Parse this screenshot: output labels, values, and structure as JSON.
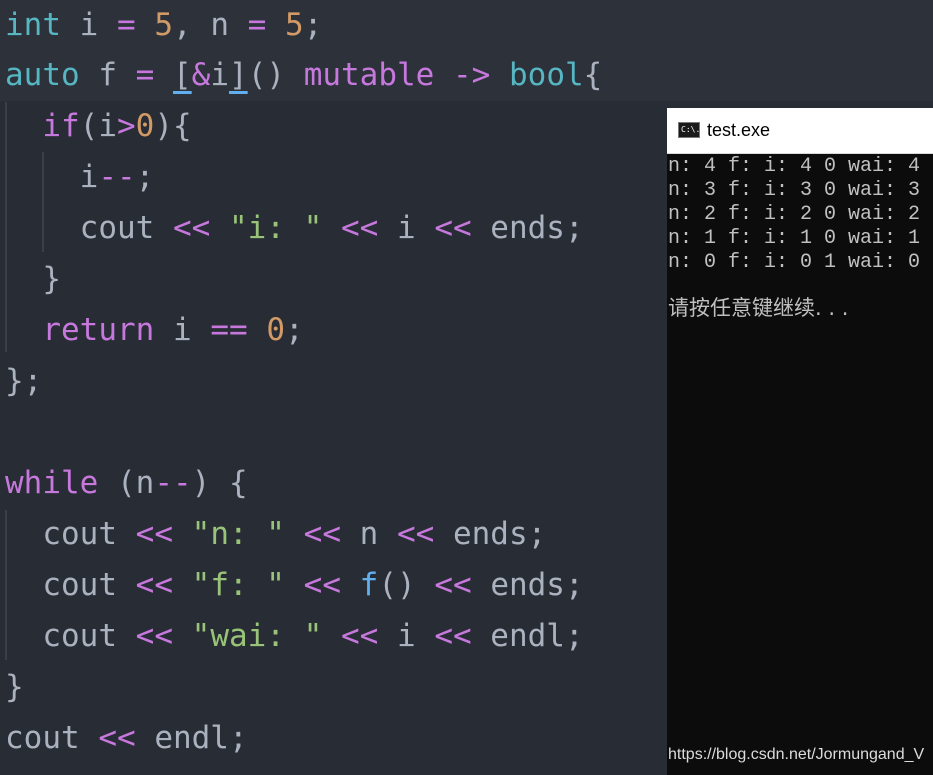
{
  "editor": {
    "lines": [
      {
        "id": "l1",
        "tokens": [
          {
            "t": "int",
            "c": "ty"
          },
          {
            "t": " i "
          },
          {
            "t": "=",
            "c": "op"
          },
          {
            "t": " "
          },
          {
            "t": "5",
            "c": "num"
          },
          {
            "t": ", n "
          },
          {
            "t": "=",
            "c": "op"
          },
          {
            "t": " "
          },
          {
            "t": "5",
            "c": "num"
          },
          {
            "t": ";"
          }
        ]
      },
      {
        "id": "l2",
        "tokens": [
          {
            "t": "auto",
            "c": "ty"
          },
          {
            "t": " f "
          },
          {
            "t": "=",
            "c": "op"
          },
          {
            "t": " "
          },
          {
            "t": "[",
            "c": "und"
          },
          {
            "t": "&",
            "c": "op"
          },
          {
            "t": "i"
          },
          {
            "t": "]",
            "c": "und"
          },
          {
            "t": "() "
          },
          {
            "t": "mutable",
            "c": "kw"
          },
          {
            "t": " "
          },
          {
            "t": "->",
            "c": "op"
          },
          {
            "t": " "
          },
          {
            "t": "bool",
            "c": "ty"
          },
          {
            "t": "{"
          }
        ]
      },
      {
        "id": "l3",
        "tokens": [
          {
            "t": "  "
          },
          {
            "t": "if",
            "c": "kw"
          },
          {
            "t": "(i"
          },
          {
            "t": ">",
            "c": "op"
          },
          {
            "t": "0",
            "c": "num"
          },
          {
            "t": "){"
          }
        ]
      },
      {
        "id": "l4",
        "tokens": [
          {
            "t": "    i"
          },
          {
            "t": "--",
            "c": "op"
          },
          {
            "t": ";"
          }
        ]
      },
      {
        "id": "l5",
        "tokens": [
          {
            "t": "    cout "
          },
          {
            "t": "<<",
            "c": "op"
          },
          {
            "t": " "
          },
          {
            "t": "\"i: \"",
            "c": "str"
          },
          {
            "t": " "
          },
          {
            "t": "<<",
            "c": "op"
          },
          {
            "t": " i "
          },
          {
            "t": "<<",
            "c": "op"
          },
          {
            "t": " ends;"
          }
        ]
      },
      {
        "id": "l6",
        "tokens": [
          {
            "t": "  }"
          }
        ]
      },
      {
        "id": "l7",
        "tokens": [
          {
            "t": "  "
          },
          {
            "t": "return",
            "c": "kw"
          },
          {
            "t": " i "
          },
          {
            "t": "==",
            "c": "op"
          },
          {
            "t": " "
          },
          {
            "t": "0",
            "c": "num"
          },
          {
            "t": ";"
          }
        ]
      },
      {
        "id": "l8",
        "tokens": [
          {
            "t": "};"
          }
        ]
      },
      {
        "id": "l9",
        "tokens": []
      },
      {
        "id": "l10",
        "tokens": [
          {
            "t": "while",
            "c": "kw"
          },
          {
            "t": " (n"
          },
          {
            "t": "--",
            "c": "op"
          },
          {
            "t": ") {"
          }
        ]
      },
      {
        "id": "l11",
        "tokens": [
          {
            "t": "  cout "
          },
          {
            "t": "<<",
            "c": "op"
          },
          {
            "t": " "
          },
          {
            "t": "\"n: \"",
            "c": "str"
          },
          {
            "t": " "
          },
          {
            "t": "<<",
            "c": "op"
          },
          {
            "t": " n "
          },
          {
            "t": "<<",
            "c": "op"
          },
          {
            "t": " ends;"
          }
        ]
      },
      {
        "id": "l12",
        "tokens": [
          {
            "t": "  cout "
          },
          {
            "t": "<<",
            "c": "op"
          },
          {
            "t": " "
          },
          {
            "t": "\"f: \"",
            "c": "str"
          },
          {
            "t": " "
          },
          {
            "t": "<<",
            "c": "op"
          },
          {
            "t": " "
          },
          {
            "t": "f",
            "c": "fn"
          },
          {
            "t": "() "
          },
          {
            "t": "<<",
            "c": "op"
          },
          {
            "t": " ends;"
          }
        ]
      },
      {
        "id": "l13",
        "tokens": [
          {
            "t": "  cout "
          },
          {
            "t": "<<",
            "c": "op"
          },
          {
            "t": " "
          },
          {
            "t": "\"wai: \"",
            "c": "str"
          },
          {
            "t": " "
          },
          {
            "t": "<<",
            "c": "op"
          },
          {
            "t": " i "
          },
          {
            "t": "<<",
            "c": "op"
          },
          {
            "t": " endl;"
          }
        ]
      },
      {
        "id": "l14",
        "tokens": [
          {
            "t": "}"
          }
        ]
      },
      {
        "id": "l15",
        "tokens": [
          {
            "t": "cout "
          },
          {
            "t": "<<",
            "c": "op"
          },
          {
            "t": " endl;"
          }
        ]
      }
    ]
  },
  "console": {
    "title": "test.exe",
    "icon": "cmd-icon",
    "icon_text": "C:\\.",
    "output_lines": [
      "n: 4 f: i: 4 0 wai: 4",
      "n: 3 f: i: 3 0 wai: 3",
      "n: 2 f: i: 2 0 wai: 2",
      "n: 1 f: i: 1 0 wai: 1",
      "n: 0 f: i: 0 1 wai: 0"
    ],
    "prompt": "请按任意键继续. . ."
  },
  "watermark": "https://blog.csdn.net/Jormungand_V"
}
